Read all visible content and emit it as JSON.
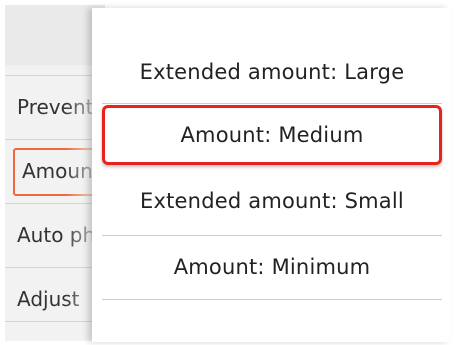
{
  "background_list": {
    "items": [
      {
        "label": "Prevent"
      },
      {
        "label": "Amount"
      },
      {
        "label": "Auto photo fix"
      },
      {
        "label": "Adjust"
      }
    ]
  },
  "popup": {
    "options": [
      {
        "label": "Extended amount: Large"
      },
      {
        "label": "Amount: Medium"
      },
      {
        "label": "Extended amount: Small"
      },
      {
        "label": "Amount: Minimum"
      }
    ],
    "focused_index": 1
  }
}
